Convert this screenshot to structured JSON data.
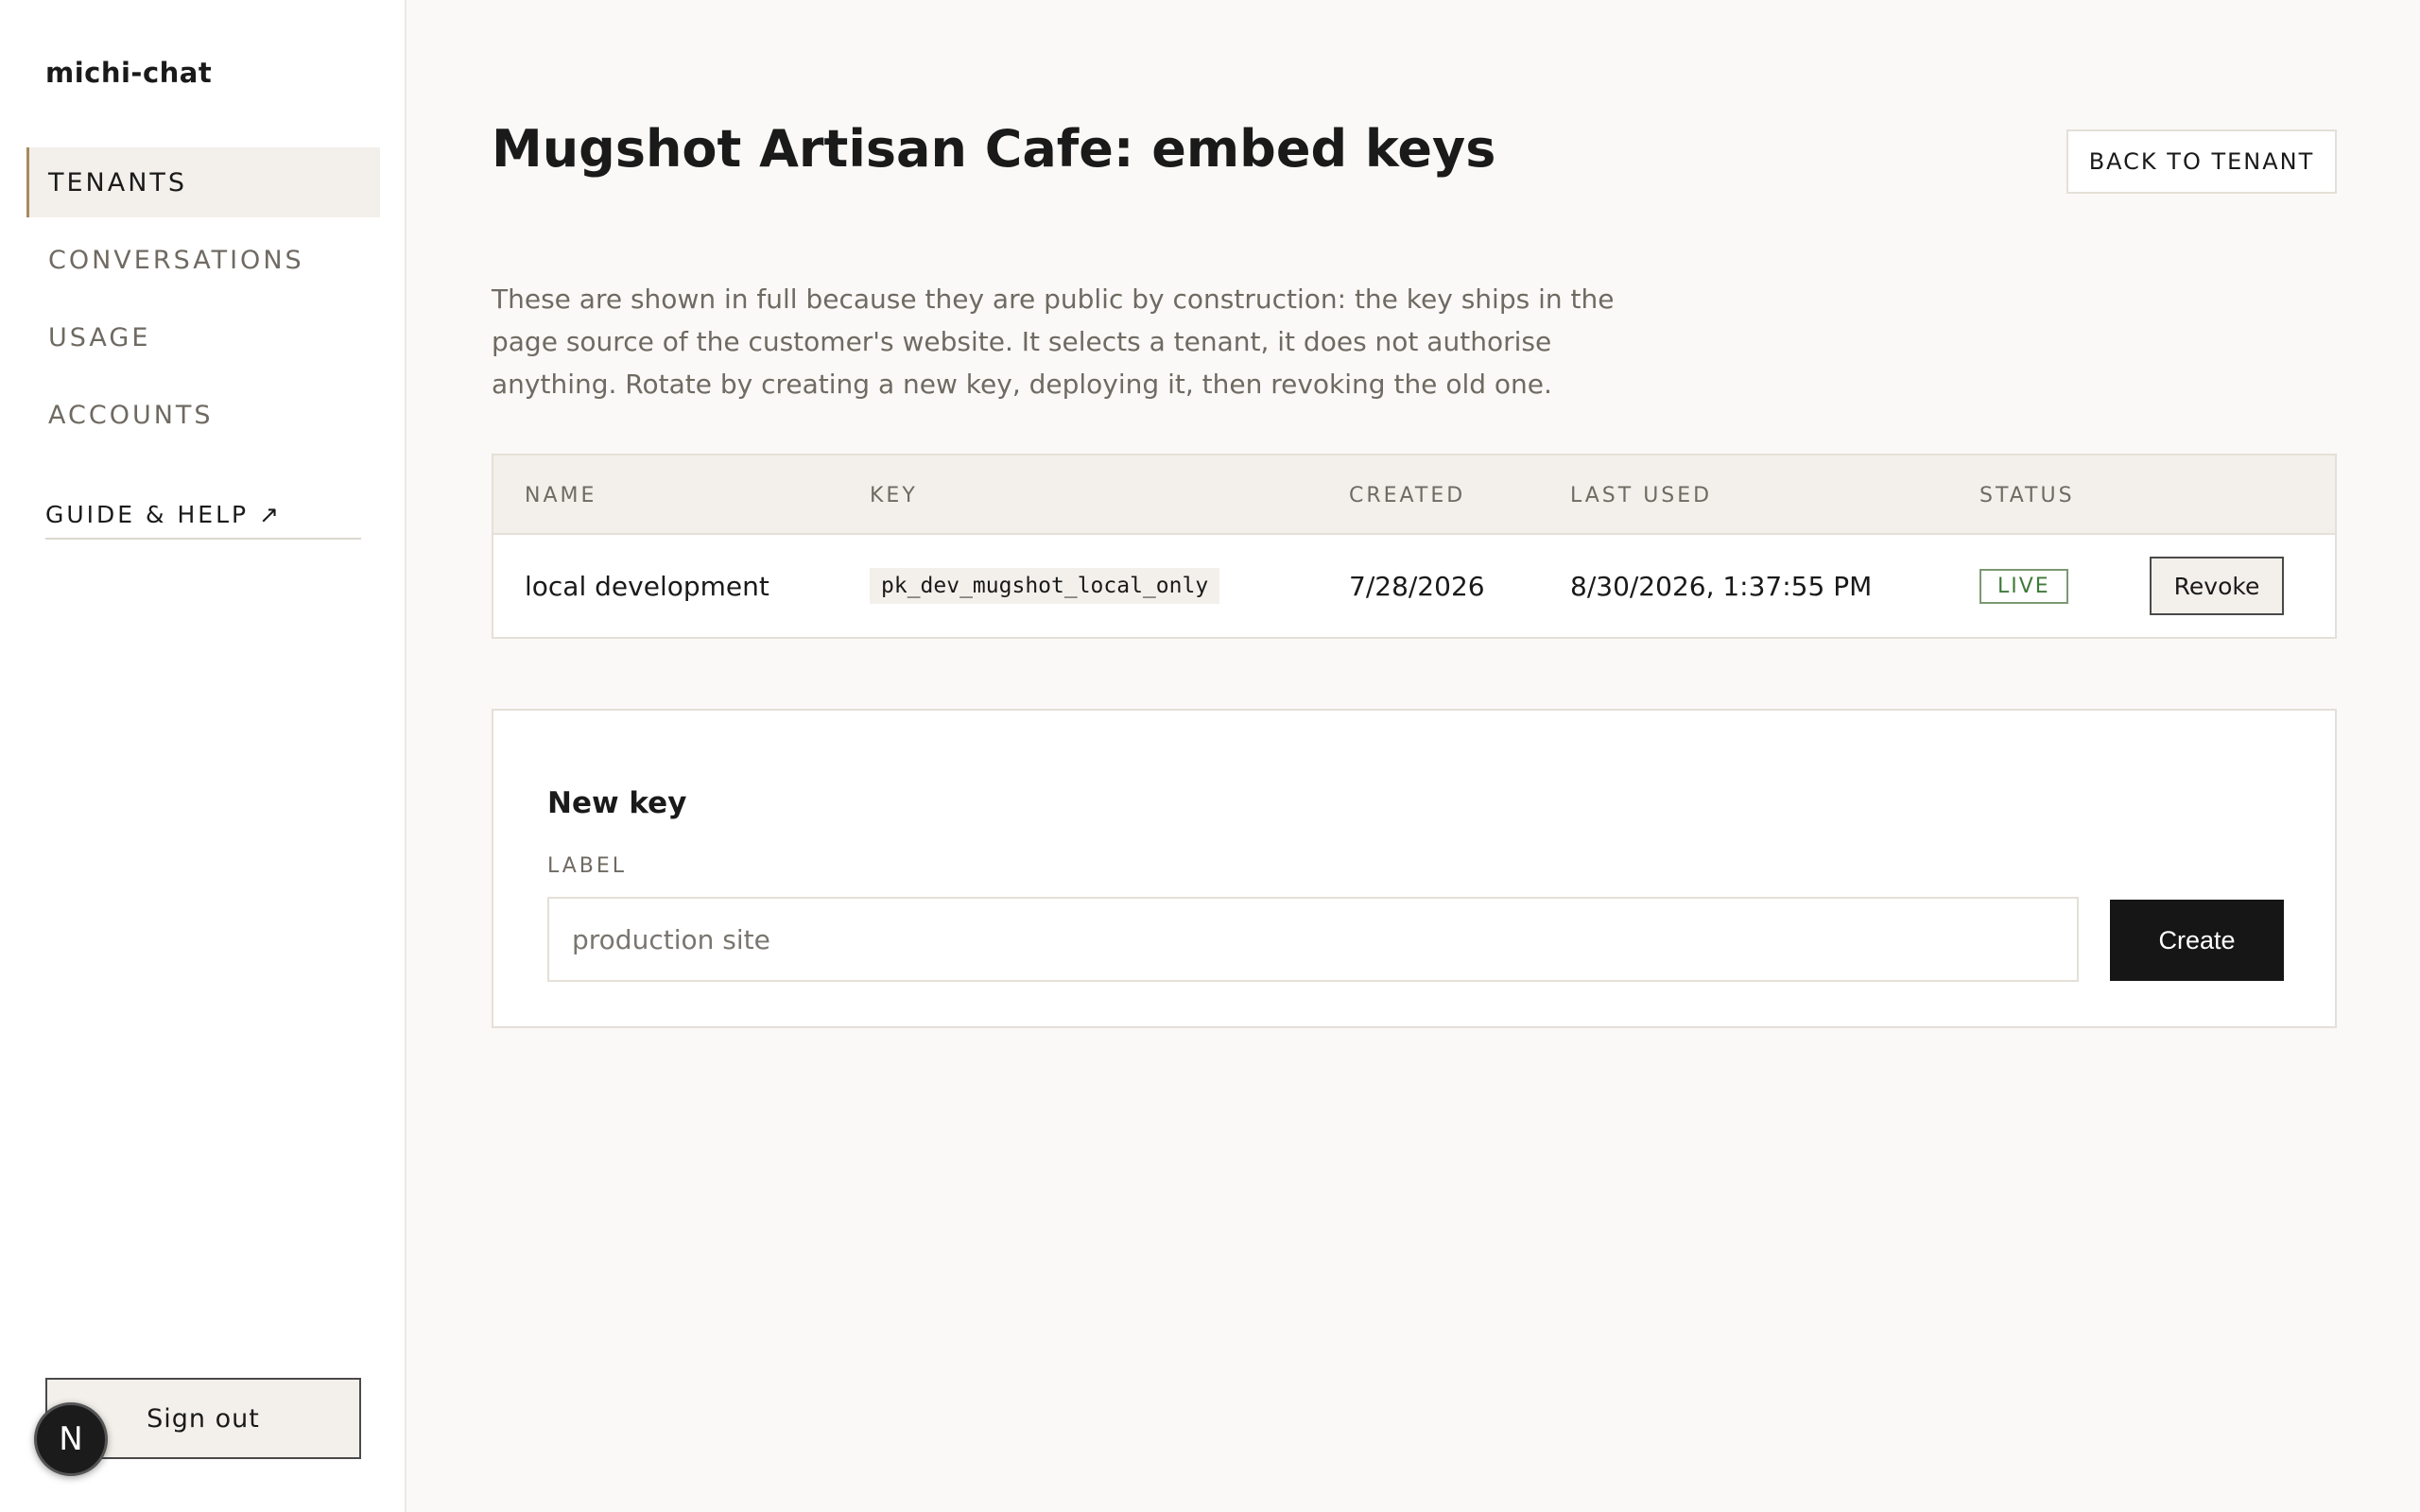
{
  "sidebar": {
    "brand": "michi-chat",
    "nav": [
      {
        "label": "TENANTS",
        "active": true
      },
      {
        "label": "CONVERSATIONS",
        "active": false
      },
      {
        "label": "USAGE",
        "active": false
      },
      {
        "label": "ACCOUNTS",
        "active": false
      }
    ],
    "guide_label": "GUIDE & HELP ↗",
    "sign_out_label": "Sign out",
    "badge_letter": "N"
  },
  "header": {
    "title": "Mugshot Artisan Cafe: embed keys",
    "back_button_label": "BACK TO TENANT"
  },
  "description": "These are shown in full because they are public by construction: the key ships in the page source of the customer's website. It selects a tenant, it does not authorise anything. Rotate by creating a new key, deploying it, then revoking the old one.",
  "keys_table": {
    "columns": [
      "NAME",
      "KEY",
      "CREATED",
      "LAST USED",
      "STATUS"
    ],
    "rows": [
      {
        "name": "local development",
        "key": "pk_dev_mugshot_local_only",
        "created": "7/28/2026",
        "last_used": "8/30/2026, 1:37:55 PM",
        "status": "LIVE",
        "action_label": "Revoke"
      }
    ]
  },
  "new_key": {
    "title": "New key",
    "field_label": "LABEL",
    "input_value": "",
    "input_placeholder": "production site",
    "create_label": "Create"
  },
  "colors": {
    "accent": "#a8895e",
    "status_live": "#3f7a3a",
    "primary_button": "#161616",
    "background": "#faf9f7"
  }
}
